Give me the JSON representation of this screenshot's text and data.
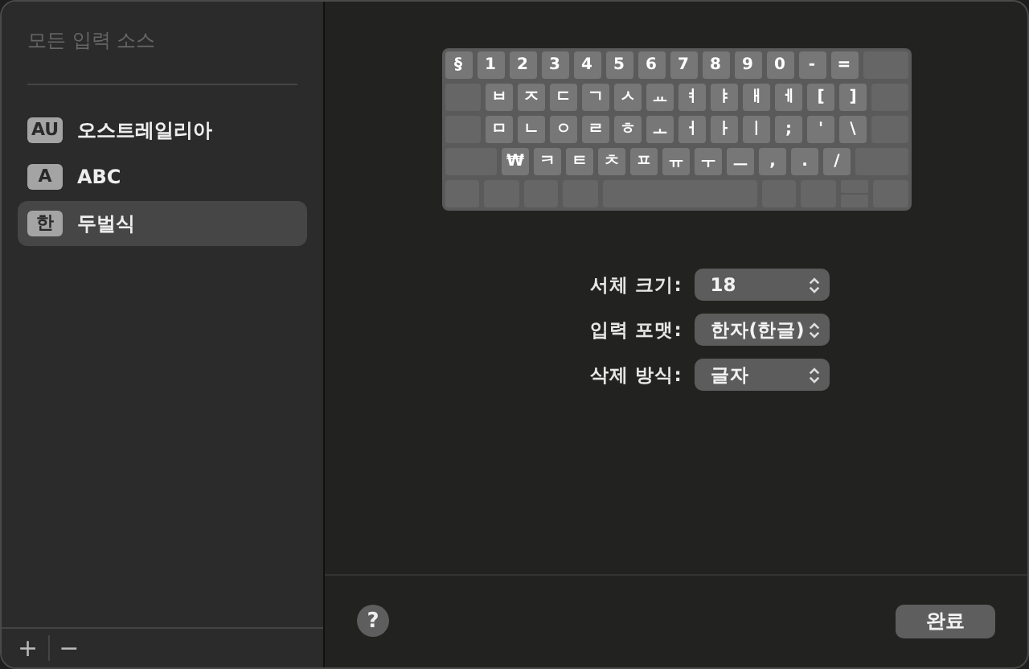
{
  "sidebar": {
    "title": "모든 입력 소스",
    "items": [
      {
        "badge": "AU",
        "label": "오스트레일리아",
        "selected": false
      },
      {
        "badge": "A",
        "label": "ABC",
        "selected": false
      },
      {
        "badge": "한",
        "label": "두벌식",
        "selected": true
      }
    ],
    "footer_buttons": [
      "+",
      "−"
    ]
  },
  "keyboard": {
    "rows": [
      [
        {
          "kind": "key",
          "label": "§"
        },
        {
          "kind": "key",
          "label": "1"
        },
        {
          "kind": "key",
          "label": "2"
        },
        {
          "kind": "key",
          "label": "3"
        },
        {
          "kind": "key",
          "label": "4"
        },
        {
          "kind": "key",
          "label": "5"
        },
        {
          "kind": "key",
          "label": "6"
        },
        {
          "kind": "key",
          "label": "7"
        },
        {
          "kind": "key",
          "label": "8"
        },
        {
          "kind": "key",
          "label": "9"
        },
        {
          "kind": "key",
          "label": "0"
        },
        {
          "kind": "key",
          "label": "-"
        },
        {
          "kind": "key",
          "label": "="
        },
        {
          "kind": "mod"
        }
      ],
      [
        {
          "kind": "mod"
        },
        {
          "kind": "key",
          "label": "ㅂ"
        },
        {
          "kind": "key",
          "label": "ㅈ"
        },
        {
          "kind": "key",
          "label": "ㄷ"
        },
        {
          "kind": "key",
          "label": "ㄱ"
        },
        {
          "kind": "key",
          "label": "ㅅ"
        },
        {
          "kind": "key",
          "label": "ㅛ"
        },
        {
          "kind": "key",
          "label": "ㅕ"
        },
        {
          "kind": "key",
          "label": "ㅑ"
        },
        {
          "kind": "key",
          "label": "ㅐ"
        },
        {
          "kind": "key",
          "label": "ㅔ"
        },
        {
          "kind": "key",
          "label": "["
        },
        {
          "kind": "key",
          "label": "]"
        },
        {
          "kind": "mod"
        }
      ],
      [
        {
          "kind": "mod"
        },
        {
          "kind": "key",
          "label": "ㅁ"
        },
        {
          "kind": "key",
          "label": "ㄴ"
        },
        {
          "kind": "key",
          "label": "ㅇ"
        },
        {
          "kind": "key",
          "label": "ㄹ"
        },
        {
          "kind": "key",
          "label": "ㅎ"
        },
        {
          "kind": "key",
          "label": "ㅗ"
        },
        {
          "kind": "key",
          "label": "ㅓ"
        },
        {
          "kind": "key",
          "label": "ㅏ"
        },
        {
          "kind": "key",
          "label": "ㅣ"
        },
        {
          "kind": "key",
          "label": ";"
        },
        {
          "kind": "key",
          "label": "'"
        },
        {
          "kind": "key",
          "label": "\\"
        },
        {
          "kind": "mod"
        }
      ],
      [
        {
          "kind": "mod"
        },
        {
          "kind": "key",
          "label": "₩"
        },
        {
          "kind": "key",
          "label": "ㅋ"
        },
        {
          "kind": "key",
          "label": "ㅌ"
        },
        {
          "kind": "key",
          "label": "ㅊ"
        },
        {
          "kind": "key",
          "label": "ㅍ"
        },
        {
          "kind": "key",
          "label": "ㅠ"
        },
        {
          "kind": "key",
          "label": "ㅜ"
        },
        {
          "kind": "key",
          "label": "ㅡ"
        },
        {
          "kind": "key",
          "label": ","
        },
        {
          "kind": "key",
          "label": "."
        },
        {
          "kind": "key",
          "label": "/"
        },
        {
          "kind": "mod"
        }
      ],
      [
        {
          "kind": "mod"
        },
        {
          "kind": "mod"
        },
        {
          "kind": "mod"
        },
        {
          "kind": "mod"
        },
        {
          "kind": "space"
        },
        {
          "kind": "mod"
        },
        {
          "kind": "mod"
        },
        {
          "kind": "arrows"
        },
        {
          "kind": "mod"
        }
      ]
    ]
  },
  "settings": [
    {
      "kind": "popup",
      "label": "서체 크기:",
      "value": "18"
    },
    {
      "kind": "popup",
      "label": "입력 포맷:",
      "value": "한자(한글)"
    },
    {
      "kind": "popup",
      "label": "삭제 방식:",
      "value": "글자"
    }
  ],
  "footer": {
    "help": "?",
    "done": "완료"
  }
}
